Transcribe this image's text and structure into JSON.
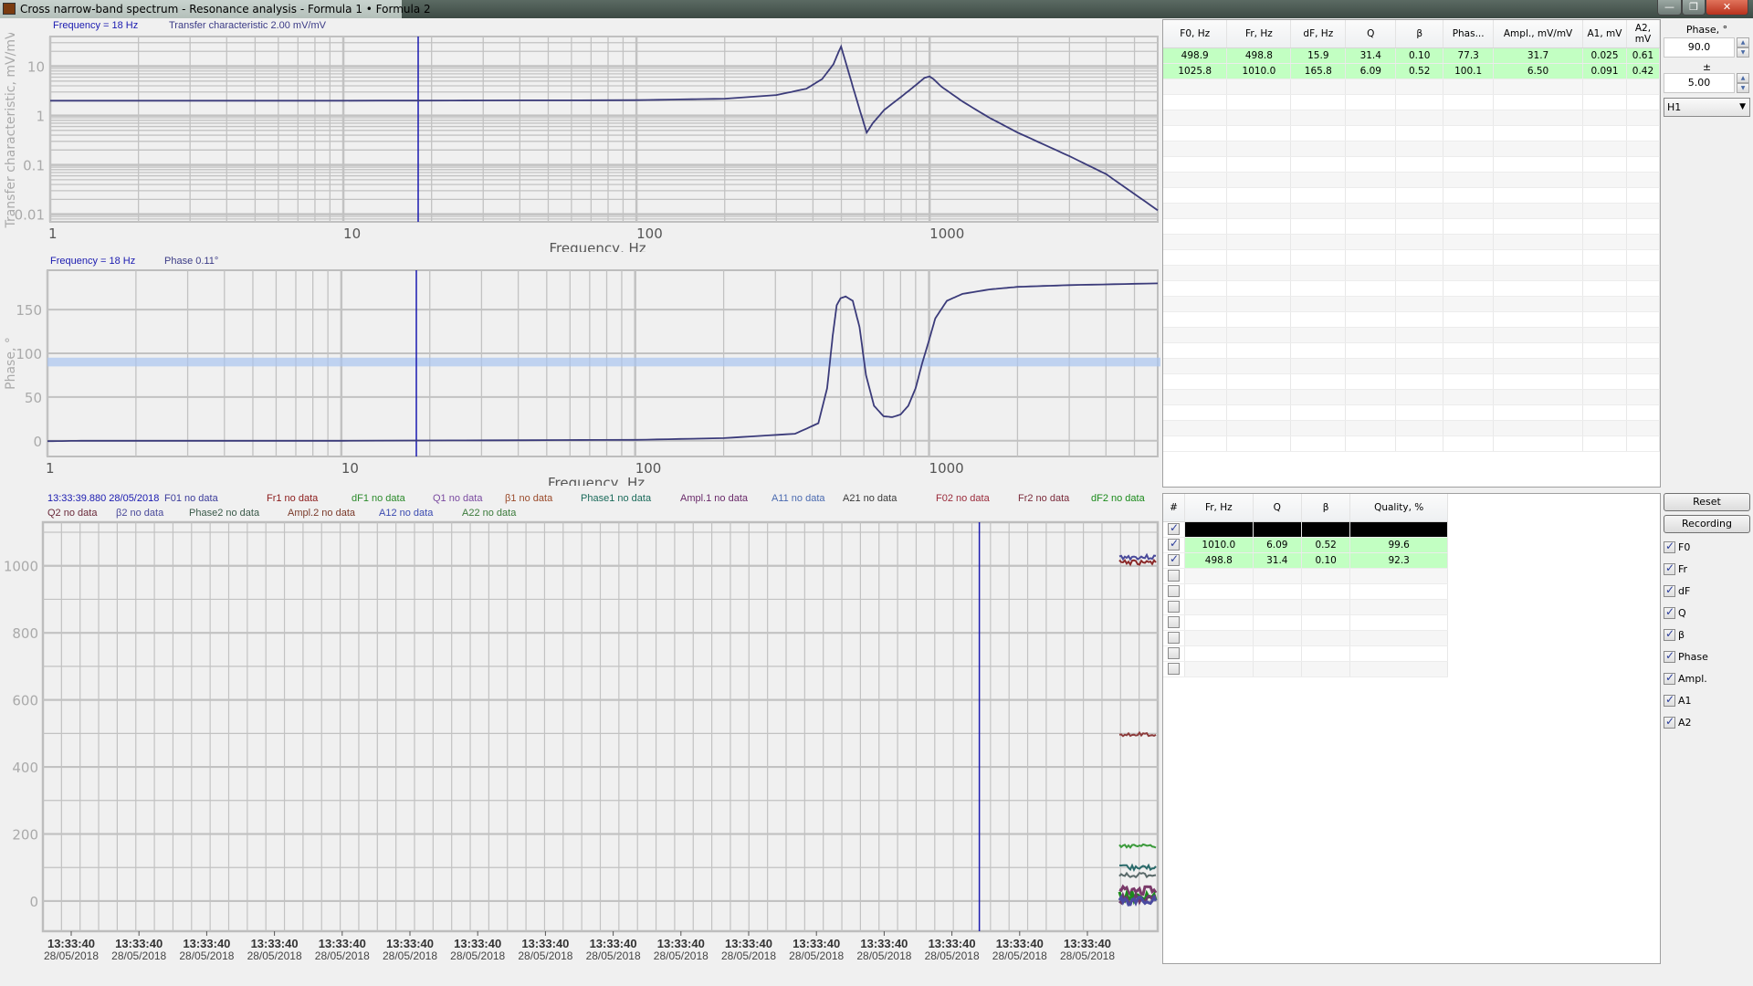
{
  "window": {
    "title": "Cross narrow-band spectrum - Resonance analysis - Formula 1 • Formula 2",
    "minimize": "—",
    "maximize": "❐",
    "close": "✕"
  },
  "transfer_chart": {
    "cursor_label": "Frequency = 18 Hz",
    "value_label": "Transfer characteristic 2.00 mV/mV"
  },
  "phase_chart": {
    "cursor_label": "Frequency = 18 Hz",
    "value_label": "Phase 0.11°"
  },
  "time_chart": {
    "timestamp": "13:33:39.880 28/05/2018",
    "legend": [
      {
        "text": "F01 no data",
        "color": "#3b3b9a"
      },
      {
        "text": "Fr1 no data",
        "color": "#8b1a1a"
      },
      {
        "text": "dF1 no data",
        "color": "#2a8a2a"
      },
      {
        "text": "Q1 no data",
        "color": "#7a4aa0"
      },
      {
        "text": "β1 no data",
        "color": "#9a4a2a"
      },
      {
        "text": "Phase1 no data",
        "color": "#1a6a5a"
      },
      {
        "text": "Ampl.1 no data",
        "color": "#6a2a6a"
      },
      {
        "text": "A11 no data",
        "color": "#4a6ab0"
      },
      {
        "text": "A21 no data",
        "color": "#3a3a3a"
      },
      {
        "text": "F02 no data",
        "color": "#9a2a3a"
      },
      {
        "text": "Fr2 no data",
        "color": "#7a2a3a"
      },
      {
        "text": "dF2 no data",
        "color": "#1a8a1a"
      },
      {
        "text": "Q2 no data",
        "color": "#6a2a3a"
      },
      {
        "text": "β2 no data",
        "color": "#4a4a9a"
      },
      {
        "text": "Phase2 no data",
        "color": "#3a5a4a"
      },
      {
        "text": "Ampl.2 no data",
        "color": "#7a3a2a"
      },
      {
        "text": "A12 no data",
        "color": "#3a4ab0"
      },
      {
        "text": "A22 no data",
        "color": "#3a7a3a"
      }
    ]
  },
  "chart_data": [
    {
      "type": "line",
      "title": "",
      "xlabel": "Frequency, Hz",
      "ylabel": "Transfer characteristic, mV/mV",
      "xscale": "log",
      "yscale": "log",
      "xlim": [
        1,
        6000
      ],
      "ylim": [
        0.007,
        40
      ],
      "xticks": [
        1,
        10,
        100,
        1000
      ],
      "xtick_labels": [
        "1",
        "10",
        "100",
        "1000"
      ],
      "yticks": [
        0.01,
        0.1,
        1,
        10
      ],
      "ytick_labels": [
        "0.01",
        "0.1",
        "1",
        "10"
      ],
      "grid": true,
      "cursor_x": 18,
      "series": [
        {
          "name": "Transfer characteristic",
          "color": "#3b3b7a",
          "x": [
            1,
            10,
            100,
            200,
            300,
            380,
            430,
            470,
            490,
            499,
            510,
            540,
            580,
            610,
            640,
            700,
            800,
            900,
            960,
            1000,
            1030,
            1100,
            1300,
            1600,
            2000,
            3000,
            4000,
            6000
          ],
          "y": [
            2.0,
            2.0,
            2.05,
            2.2,
            2.6,
            3.5,
            5.5,
            11,
            20,
            25,
            16,
            5,
            1.2,
            0.45,
            0.7,
            1.3,
            2.4,
            4.2,
            5.8,
            6.2,
            5.5,
            3.8,
            1.9,
            0.9,
            0.45,
            0.15,
            0.065,
            0.012
          ]
        }
      ]
    },
    {
      "type": "line",
      "title": "",
      "xlabel": "Frequency, Hz",
      "ylabel": "Phase, °",
      "xscale": "log",
      "xlim": [
        1,
        6000
      ],
      "ylim": [
        -18,
        195
      ],
      "xticks": [
        1,
        10,
        100,
        1000
      ],
      "xtick_labels": [
        "1",
        "10",
        "100",
        "1000"
      ],
      "yticks": [
        0,
        50,
        100,
        150
      ],
      "ytick_labels": [
        "0",
        "50",
        "100",
        "150"
      ],
      "grid": true,
      "cursor_x": 18,
      "band": {
        "center": 90,
        "tolerance": 5
      },
      "series": [
        {
          "name": "Phase",
          "color": "#3b3b7a",
          "x": [
            1,
            1.35,
            10,
            100,
            200,
            350,
            420,
            450,
            470,
            485,
            500,
            520,
            550,
            580,
            610,
            650,
            700,
            750,
            800,
            850,
            900,
            950,
            1000,
            1050,
            1150,
            1300,
            1600,
            2000,
            3000,
            6000
          ],
          "y": [
            -0.5,
            0,
            0,
            1,
            3,
            8,
            20,
            60,
            120,
            155,
            163,
            165,
            160,
            130,
            75,
            40,
            28,
            27,
            30,
            40,
            60,
            90,
            115,
            140,
            160,
            168,
            173,
            176,
            178,
            180
          ]
        }
      ]
    },
    {
      "type": "line",
      "title": "",
      "xlabel": "",
      "ylabel": "",
      "ylim": [
        -90,
        1130
      ],
      "yticks": [
        0,
        200,
        400,
        600,
        800,
        1000
      ],
      "ytick_labels": [
        "0",
        "200",
        "400",
        "600",
        "800",
        "1000"
      ],
      "xtick_labels": [
        [
          "13:33:40",
          "28/05/2018"
        ],
        [
          "13:33:40",
          "28/05/2018"
        ],
        [
          "13:33:40",
          "28/05/2018"
        ],
        [
          "13:33:40",
          "28/05/2018"
        ],
        [
          "13:33:40",
          "28/05/2018"
        ],
        [
          "13:33:40",
          "28/05/2018"
        ],
        [
          "13:33:40",
          "28/05/2018"
        ],
        [
          "13:33:40",
          "28/05/2018"
        ],
        [
          "13:33:40",
          "28/05/2018"
        ],
        [
          "13:33:40",
          "28/05/2018"
        ],
        [
          "13:33:40",
          "28/05/2018"
        ],
        [
          "13:33:40",
          "28/05/2018"
        ],
        [
          "13:33:40",
          "28/05/2018"
        ],
        [
          "13:33:40",
          "28/05/2018"
        ],
        [
          "13:33:40",
          "28/05/2018"
        ],
        [
          "13:33:40",
          "28/05/2018"
        ]
      ],
      "grid": true,
      "cursor_position_fraction": 0.84,
      "series": [
        {
          "name": "F0 (1)",
          "color": "#4a4a9a",
          "value": 1025.8
        },
        {
          "name": "Fr (1)",
          "color": "#8b2a2a",
          "value": 1010.0
        },
        {
          "name": "F0 (2)",
          "color": "#8b3a3a",
          "value": 498.9
        },
        {
          "name": "dF (2)",
          "color": "#3a9a3a",
          "value": 165.8
        },
        {
          "name": "Phase",
          "color": "#2a6a6a",
          "value": 100.1
        },
        {
          "name": "Ampl.",
          "color": "#5a6a6a",
          "value": 77.3
        },
        {
          "name": "Q (1)",
          "color": "#7a3a6a",
          "value": 31.4
        },
        {
          "name": "dF (1)",
          "color": "#1a8a1a",
          "value": 15.9
        },
        {
          "name": "Q (2)",
          "color": "#6a3a6a",
          "value": 6.09
        },
        {
          "name": "A",
          "color": "#4a4aa0",
          "value": 0.5
        }
      ]
    }
  ],
  "results_table": {
    "columns": [
      "F0, Hz",
      "Fr, Hz",
      "dF, Hz",
      "Q",
      "β",
      "Phas...",
      "Ampl., mV/mV",
      "A1, mV",
      "A2, mV"
    ],
    "rows": [
      [
        "498.9",
        "498.8",
        "15.9",
        "31.4",
        "0.10",
        "77.3",
        "31.7",
        "0.025",
        "0.61"
      ],
      [
        "1025.8",
        "1010.0",
        "165.8",
        "6.09",
        "0.52",
        "100.1",
        "6.50",
        "0.091",
        "0.42"
      ]
    ]
  },
  "quality_table": {
    "columns": [
      "#",
      "Fr, Hz",
      "Q",
      "β",
      "Quality, %"
    ],
    "rows": [
      {
        "checked": true,
        "cells": [
          "",
          "",
          "",
          ""
        ],
        "style": "black"
      },
      {
        "checked": true,
        "cells": [
          "1010.0",
          "6.09",
          "0.52",
          "99.6"
        ],
        "style": "green"
      },
      {
        "checked": true,
        "cells": [
          "498.8",
          "31.4",
          "0.10",
          "92.3"
        ],
        "style": "green"
      },
      {
        "checked": false,
        "cells": [
          "",
          "",
          "",
          ""
        ],
        "style": "alt"
      },
      {
        "checked": false,
        "cells": [
          "",
          "",
          "",
          ""
        ],
        "style": ""
      },
      {
        "checked": false,
        "cells": [
          "",
          "",
          "",
          ""
        ],
        "style": "alt"
      },
      {
        "checked": false,
        "cells": [
          "",
          "",
          "",
          ""
        ],
        "style": ""
      },
      {
        "checked": false,
        "cells": [
          "",
          "",
          "",
          ""
        ],
        "style": "alt"
      },
      {
        "checked": false,
        "cells": [
          "",
          "",
          "",
          ""
        ],
        "style": ""
      },
      {
        "checked": false,
        "cells": [
          "",
          "",
          "",
          ""
        ],
        "style": "alt"
      }
    ]
  },
  "controls": {
    "phase_label": "Phase, °",
    "phase_value": "90.0",
    "tolerance_label": "±",
    "tolerance_value": "5.00",
    "channel_select": "H1",
    "reset_button": "Reset",
    "recording_button": "Recording",
    "checkboxes": [
      {
        "label": "F0",
        "checked": true
      },
      {
        "label": "Fr",
        "checked": true
      },
      {
        "label": "dF",
        "checked": true
      },
      {
        "label": "Q",
        "checked": true
      },
      {
        "label": "β",
        "checked": true
      },
      {
        "label": "Phase",
        "checked": true
      },
      {
        "label": "Ampl.",
        "checked": true
      },
      {
        "label": "A1",
        "checked": true
      },
      {
        "label": "A2",
        "checked": true
      }
    ]
  }
}
